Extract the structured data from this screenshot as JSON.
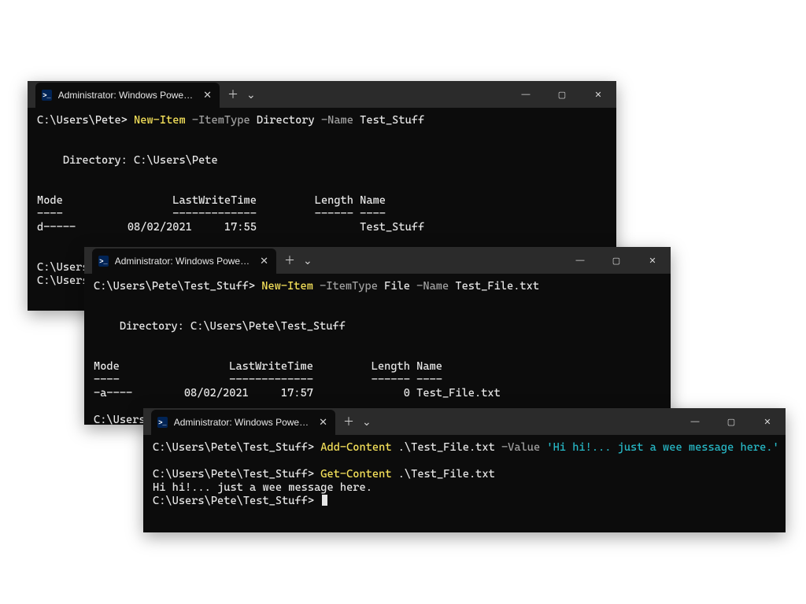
{
  "tab_title": "Administrator: Windows PowerShell",
  "icon_glyph": ">_",
  "win1": {
    "l1_prompt": "C:\\Users\\Pete> ",
    "l1_cmd": "New-Item",
    "l1_p1": " -ItemType ",
    "l1_a1": "Directory",
    "l1_p2": " -Name ",
    "l1_a2": "Test_Stuff",
    "dirline": "    Directory: C:\\Users\\Pete",
    "hdr": "Mode                 LastWriteTime         Length Name",
    "hdr_sep": "----                 -------------         ------ ----",
    "row": "d-----        08/02/2021     17:55                Test_Stuff",
    "l2_prompt": "C:\\Users",
    "l3_prompt": "C:\\Users"
  },
  "win2": {
    "l1_prompt": "C:\\Users\\Pete\\Test_Stuff> ",
    "l1_cmd": "New-Item",
    "l1_p1": " -ItemType ",
    "l1_a1": "File",
    "l1_p2": " -Name ",
    "l1_a2": "Test_File.txt",
    "dirline": "    Directory: C:\\Users\\Pete\\Test_Stuff",
    "hdr": "Mode                 LastWriteTime         Length Name",
    "hdr_sep": "----                 -------------         ------ ----",
    "row": "-a----        08/02/2021     17:57              0 Test_File.txt",
    "l2_prompt": "C:\\Users"
  },
  "win3": {
    "l1_prompt": "C:\\Users\\Pete\\Test_Stuff> ",
    "l1_cmd": "Add-Content",
    "l1_arg": " .\\Test_File.txt ",
    "l1_p1": "-Value ",
    "l1_str": "'Hi hi!... just a wee message here.'",
    "l2_prompt": "C:\\Users\\Pete\\Test_Stuff> ",
    "l2_cmd": "Get-Content",
    "l2_arg": " .\\Test_File.txt",
    "output": "Hi hi!... just a wee message here.",
    "l3_prompt": "C:\\Users\\Pete\\Test_Stuff> "
  }
}
